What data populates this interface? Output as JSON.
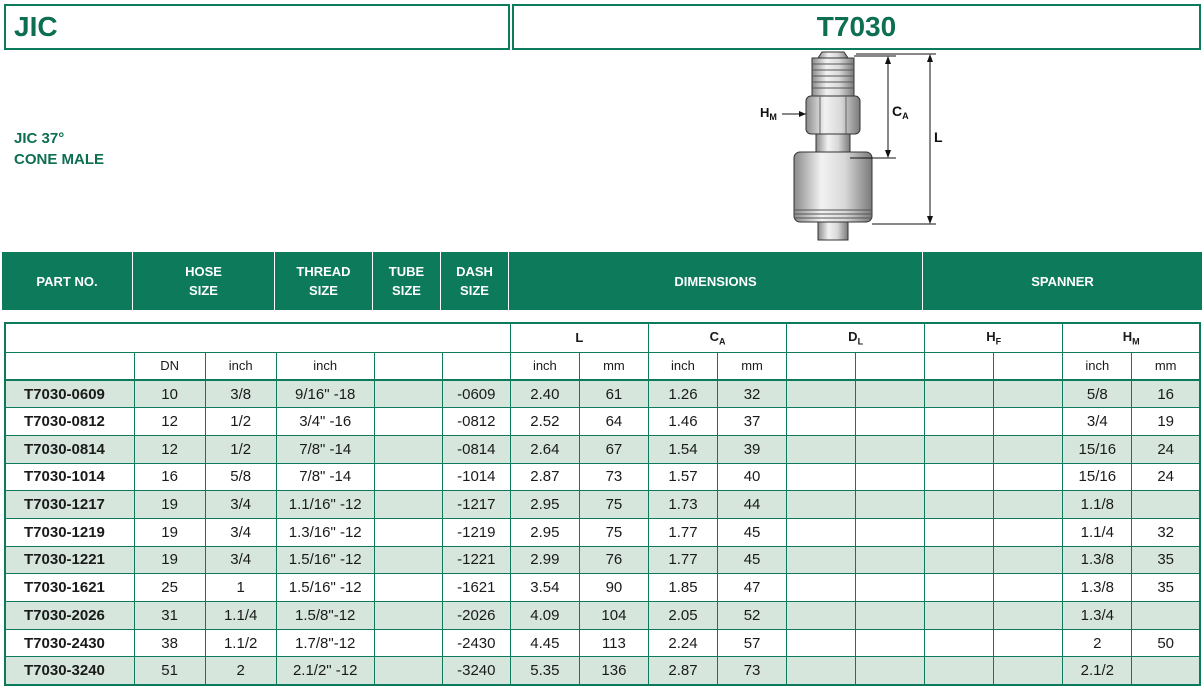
{
  "header": {
    "left_title": "JIC",
    "right_title": "T7030"
  },
  "subtitle": {
    "line1": "JIC 37°",
    "line2": "CONE MALE"
  },
  "drawing": {
    "label_hm": "H",
    "label_hm_sub": "M",
    "label_ca": "C",
    "label_ca_sub": "A",
    "label_l": "L"
  },
  "columns": {
    "part_no": "PART NO.",
    "hose_size_1": "HOSE",
    "hose_size_2": "SIZE",
    "thread_size_1": "THREAD",
    "thread_size_2": "SIZE",
    "tube_size_1": "TUBE",
    "tube_size_2": "SIZE",
    "dash_size_1": "DASH",
    "dash_size_2": "SIZE",
    "dimensions": "DIMENSIONS",
    "spanner": "SPANNER"
  },
  "subheaders": {
    "L": "L",
    "CA": "C",
    "CA_sub": "A",
    "DL": "D",
    "DL_sub": "L",
    "HF": "H",
    "HF_sub": "F",
    "HM": "H",
    "HM_sub": "M",
    "dn": "DN",
    "inch": "inch",
    "mm": "mm"
  },
  "rows": [
    {
      "part": "T7030-0609",
      "dn": "10",
      "hose_inch": "3/8",
      "thread": "9/16\" -18",
      "tube": "",
      "dash": "-0609",
      "l_inch": "2.40",
      "l_mm": "61",
      "ca_inch": "1.26",
      "ca_mm": "32",
      "dl_inch": "",
      "dl_mm": "",
      "hf_inch": "",
      "hf_mm": "",
      "hm_inch": "5/8",
      "hm_mm": "16"
    },
    {
      "part": "T7030-0812",
      "dn": "12",
      "hose_inch": "1/2",
      "thread": "3/4\" -16",
      "tube": "",
      "dash": "-0812",
      "l_inch": "2.52",
      "l_mm": "64",
      "ca_inch": "1.46",
      "ca_mm": "37",
      "dl_inch": "",
      "dl_mm": "",
      "hf_inch": "",
      "hf_mm": "",
      "hm_inch": "3/4",
      "hm_mm": "19"
    },
    {
      "part": "T7030-0814",
      "dn": "12",
      "hose_inch": "1/2",
      "thread": "7/8\" -14",
      "tube": "",
      "dash": "-0814",
      "l_inch": "2.64",
      "l_mm": "67",
      "ca_inch": "1.54",
      "ca_mm": "39",
      "dl_inch": "",
      "dl_mm": "",
      "hf_inch": "",
      "hf_mm": "",
      "hm_inch": "15/16",
      "hm_mm": "24"
    },
    {
      "part": "T7030-1014",
      "dn": "16",
      "hose_inch": "5/8",
      "thread": "7/8\" -14",
      "tube": "",
      "dash": "-1014",
      "l_inch": "2.87",
      "l_mm": "73",
      "ca_inch": "1.57",
      "ca_mm": "40",
      "dl_inch": "",
      "dl_mm": "",
      "hf_inch": "",
      "hf_mm": "",
      "hm_inch": "15/16",
      "hm_mm": "24"
    },
    {
      "part": "T7030-1217",
      "dn": "19",
      "hose_inch": "3/4",
      "thread": "1.1/16\" -12",
      "tube": "",
      "dash": "-1217",
      "l_inch": "2.95",
      "l_mm": "75",
      "ca_inch": "1.73",
      "ca_mm": "44",
      "dl_inch": "",
      "dl_mm": "",
      "hf_inch": "",
      "hf_mm": "",
      "hm_inch": "1.1/8",
      "hm_mm": ""
    },
    {
      "part": "T7030-1219",
      "dn": "19",
      "hose_inch": "3/4",
      "thread": "1.3/16\" -12",
      "tube": "",
      "dash": "-1219",
      "l_inch": "2.95",
      "l_mm": "75",
      "ca_inch": "1.77",
      "ca_mm": "45",
      "dl_inch": "",
      "dl_mm": "",
      "hf_inch": "",
      "hf_mm": "",
      "hm_inch": "1.1/4",
      "hm_mm": "32"
    },
    {
      "part": "T7030-1221",
      "dn": "19",
      "hose_inch": "3/4",
      "thread": "1.5/16\" -12",
      "tube": "",
      "dash": "-1221",
      "l_inch": "2.99",
      "l_mm": "76",
      "ca_inch": "1.77",
      "ca_mm": "45",
      "dl_inch": "",
      "dl_mm": "",
      "hf_inch": "",
      "hf_mm": "",
      "hm_inch": "1.3/8",
      "hm_mm": "35"
    },
    {
      "part": "T7030-1621",
      "dn": "25",
      "hose_inch": "1",
      "thread": "1.5/16\" -12",
      "tube": "",
      "dash": "-1621",
      "l_inch": "3.54",
      "l_mm": "90",
      "ca_inch": "1.85",
      "ca_mm": "47",
      "dl_inch": "",
      "dl_mm": "",
      "hf_inch": "",
      "hf_mm": "",
      "hm_inch": "1.3/8",
      "hm_mm": "35"
    },
    {
      "part": "T7030-2026",
      "dn": "31",
      "hose_inch": "1.1/4",
      "thread": "1.5/8\"-12",
      "tube": "",
      "dash": "-2026",
      "l_inch": "4.09",
      "l_mm": "104",
      "ca_inch": "2.05",
      "ca_mm": "52",
      "dl_inch": "",
      "dl_mm": "",
      "hf_inch": "",
      "hf_mm": "",
      "hm_inch": "1.3/4",
      "hm_mm": ""
    },
    {
      "part": "T7030-2430",
      "dn": "38",
      "hose_inch": "1.1/2",
      "thread": "1.7/8\"-12",
      "tube": "",
      "dash": "-2430",
      "l_inch": "4.45",
      "l_mm": "113",
      "ca_inch": "2.24",
      "ca_mm": "57",
      "dl_inch": "",
      "dl_mm": "",
      "hf_inch": "",
      "hf_mm": "",
      "hm_inch": "2",
      "hm_mm": "50"
    },
    {
      "part": "T7030-3240",
      "dn": "51",
      "hose_inch": "2",
      "thread": "2.1/2\" -12",
      "tube": "",
      "dash": "-3240",
      "l_inch": "5.35",
      "l_mm": "136",
      "ca_inch": "2.87",
      "ca_mm": "73",
      "dl_inch": "",
      "dl_mm": "",
      "hf_inch": "",
      "hf_mm": "",
      "hm_inch": "2.1/2",
      "hm_mm": ""
    }
  ]
}
